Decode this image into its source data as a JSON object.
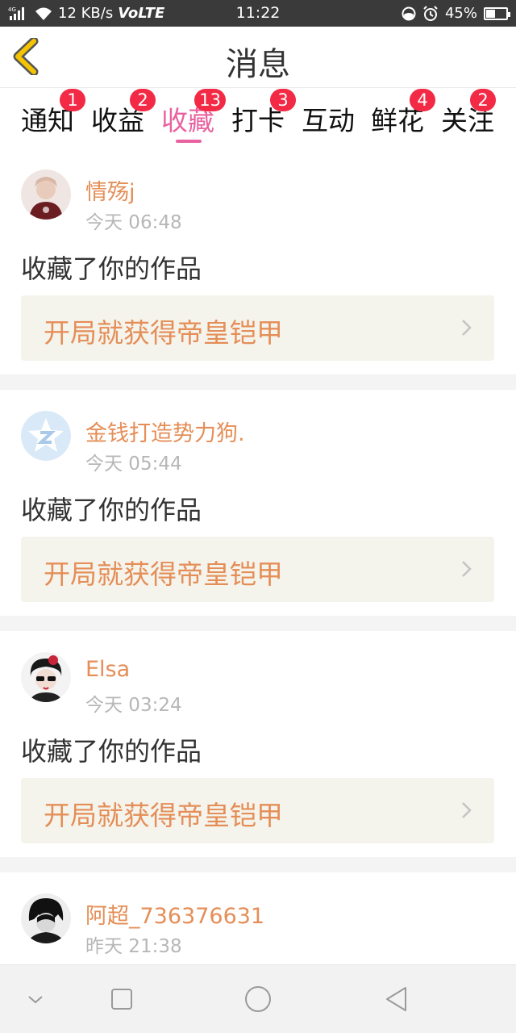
{
  "status_bar": {
    "network": "4G",
    "speed": "12 KB/s",
    "volte": "VoLTE",
    "time": "11:22",
    "battery": "45%",
    "battery_level": 0.45
  },
  "header": {
    "title": "消息"
  },
  "tabs": [
    {
      "label": "通知",
      "badge": "1"
    },
    {
      "label": "收益",
      "badge": "2"
    },
    {
      "label": "收藏",
      "badge": "13"
    },
    {
      "label": "打卡",
      "badge": "3"
    },
    {
      "label": "互动",
      "badge": ""
    },
    {
      "label": "鲜花",
      "badge": "4"
    },
    {
      "label": "关注",
      "badge": "2"
    }
  ],
  "active_tab": "收藏",
  "messages": [
    {
      "user": "情殇j",
      "time": "今天 06:48",
      "action": "收藏了你的作品",
      "work": "开局就获得帝皇铠甲"
    },
    {
      "user": "金钱打造势力狗.",
      "time": "今天 05:44",
      "action": "收藏了你的作品",
      "work": "开局就获得帝皇铠甲"
    },
    {
      "user": "Elsa",
      "time": "今天 03:24",
      "action": "收藏了你的作品",
      "work": "开局就获得帝皇铠甲"
    },
    {
      "user": "阿超_736376631",
      "time": "昨天 21:38",
      "action": "",
      "work": ""
    }
  ],
  "colors": {
    "accent_pink": "#e962a0",
    "name_orange": "#e58e57",
    "badge_red": "#f32a45",
    "back_yellow": "#f5c400"
  }
}
